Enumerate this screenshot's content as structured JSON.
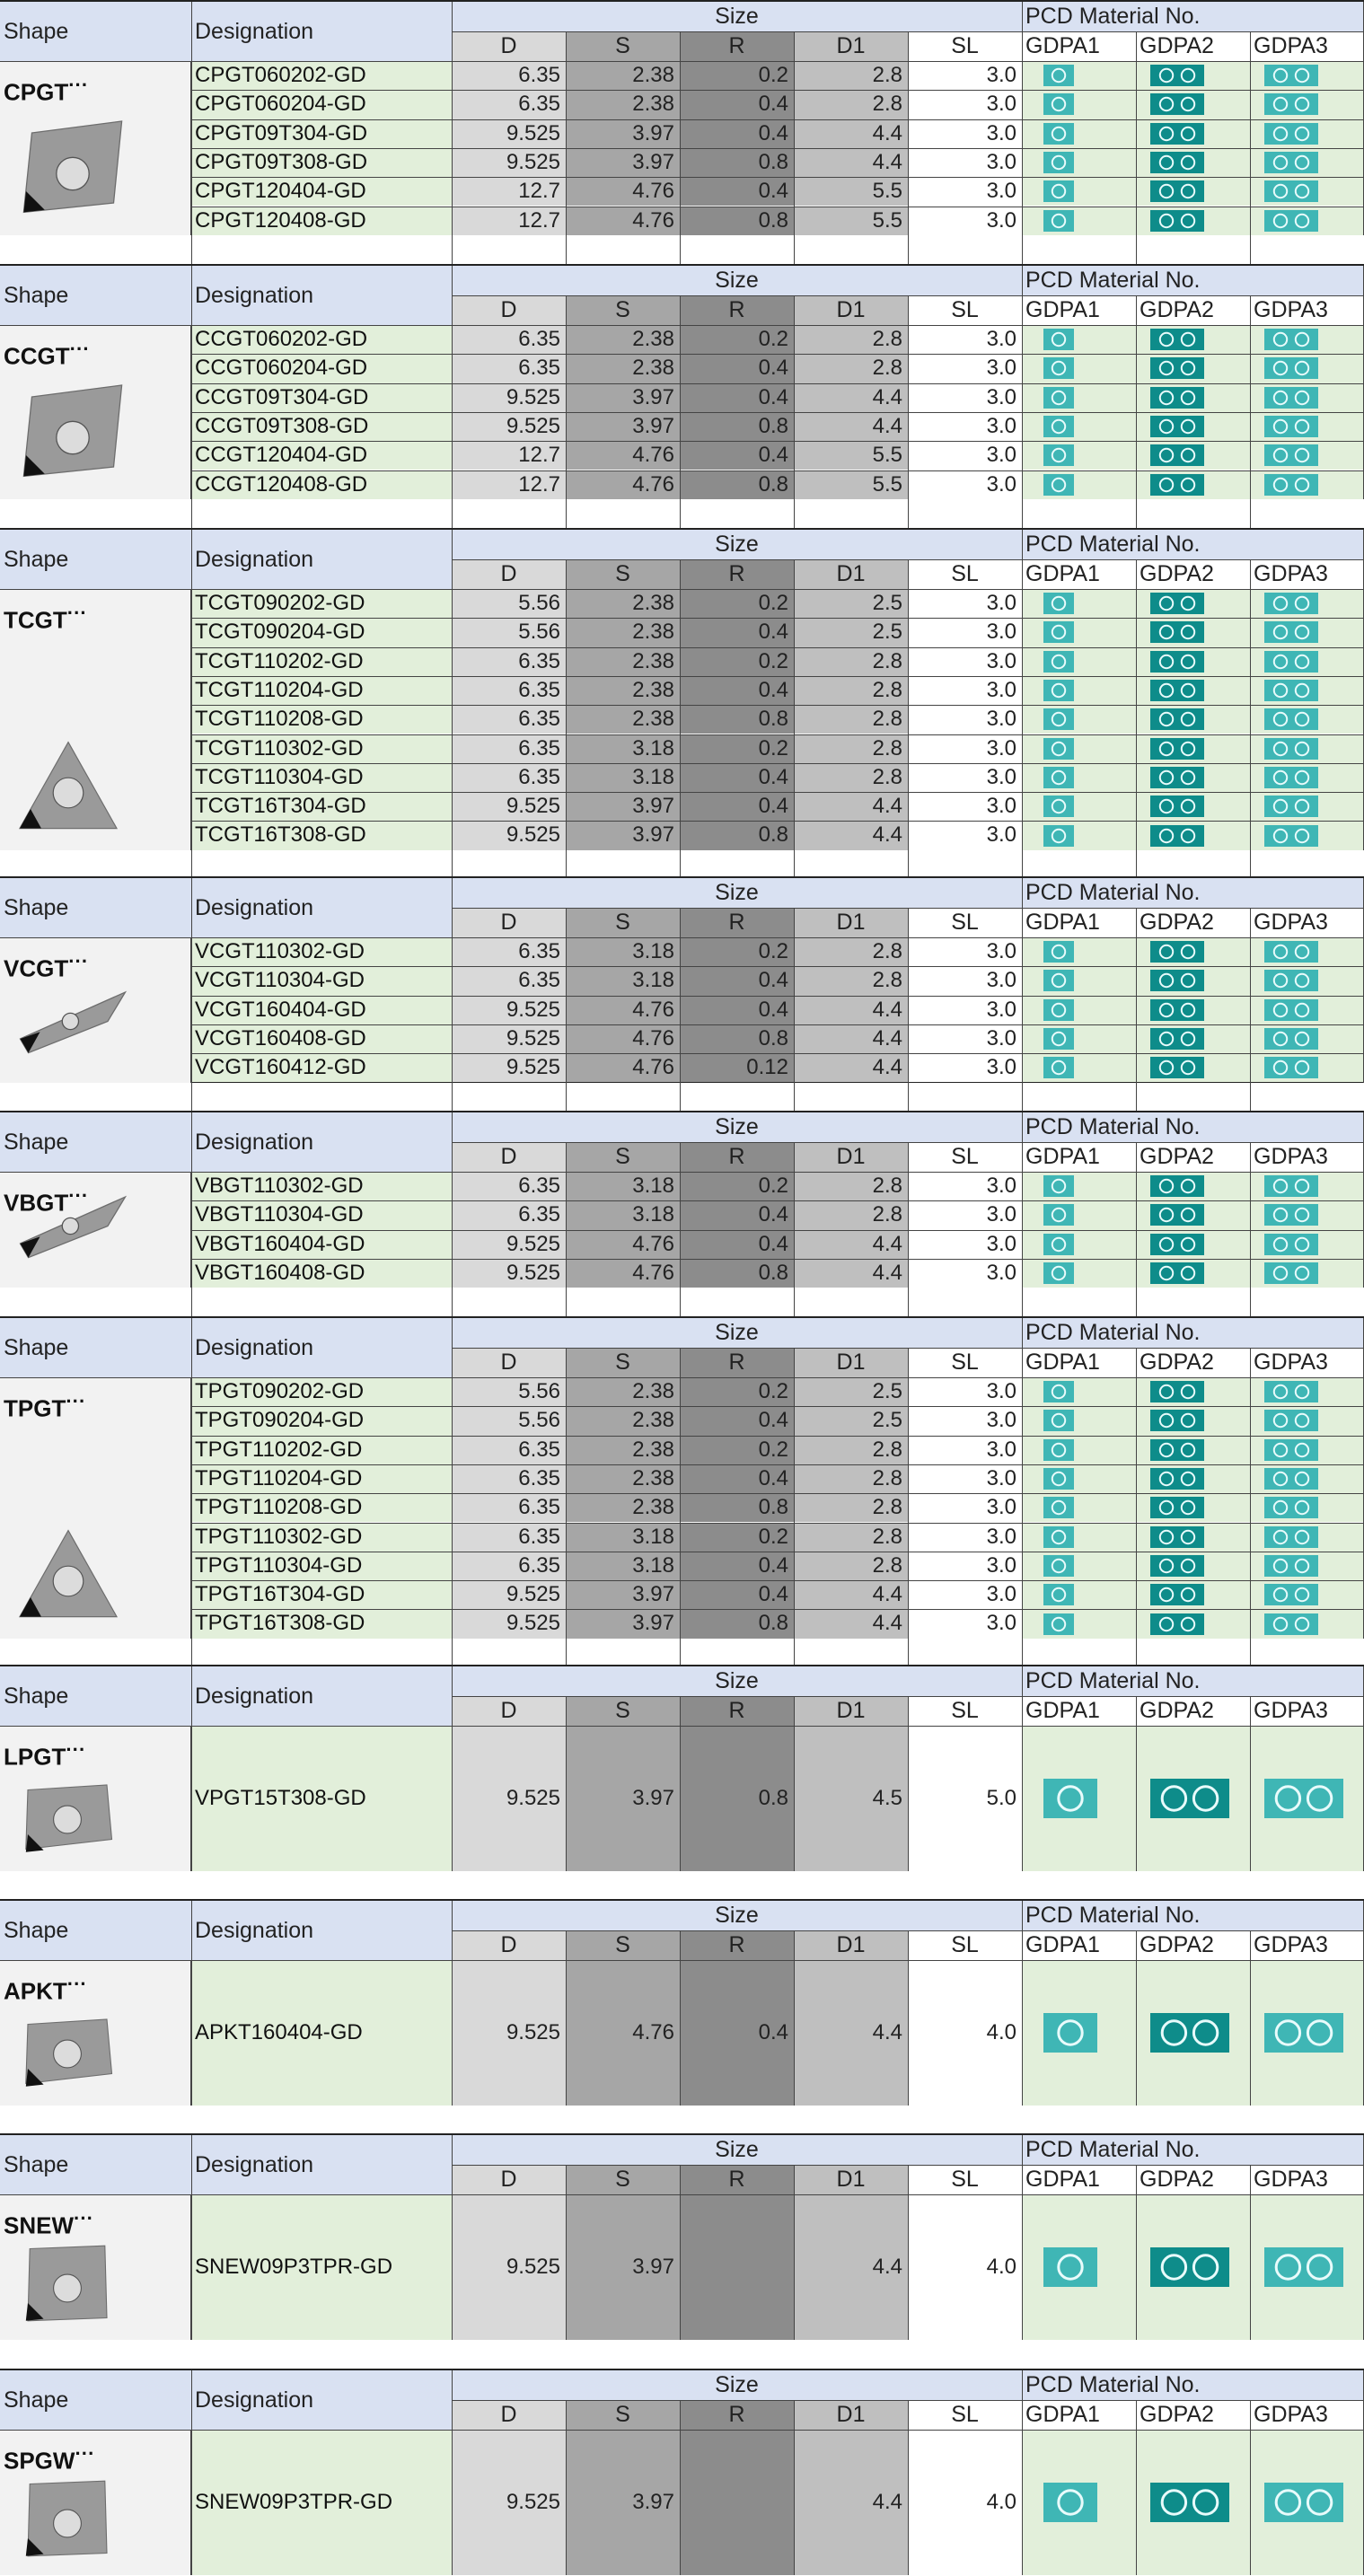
{
  "headers": {
    "shape": "Shape",
    "designation": "Designation",
    "size": "Size",
    "pcd": "PCD Material No.",
    "cols": [
      "D",
      "S",
      "R",
      "D1",
      "SL"
    ],
    "materials": [
      "GDPA1",
      "GDPA2",
      "GDPA3"
    ]
  },
  "colors": {
    "header_blue": "#d9e1f2",
    "row_green": "#e2efda",
    "gray_d": "#d9d9d9",
    "gray_s": "#a6a6a6",
    "gray_r": "#8c8c8c",
    "gray_d1": "#bfbfbf",
    "chip_light": "#3fb6b5",
    "chip_dark": "#0e8c8a"
  },
  "tables": [
    {
      "name": "CPGT",
      "dots": "···",
      "shape_icon": "rhombic-insert-icon",
      "rows": [
        {
          "des": "CPGT060202-GD",
          "D": "6.35",
          "S": "2.38",
          "R": "0.2",
          "D1": "2.8",
          "SL": "3.0"
        },
        {
          "des": "CPGT060204-GD",
          "D": "6.35",
          "S": "2.38",
          "R": "0.4",
          "D1": "2.8",
          "SL": "3.0"
        },
        {
          "des": "CPGT09T304-GD",
          "D": "9.525",
          "S": "3.97",
          "R": "0.4",
          "D1": "4.4",
          "SL": "3.0"
        },
        {
          "des": "CPGT09T308-GD",
          "D": "9.525",
          "S": "3.97",
          "R": "0.8",
          "D1": "4.4",
          "SL": "3.0"
        },
        {
          "des": "CPGT120404-GD",
          "D": "12.7",
          "S": "4.76",
          "R": "0.4",
          "D1": "5.5",
          "SL": "3.0"
        },
        {
          "des": "CPGT120408-GD",
          "D": "12.7",
          "S": "4.76",
          "R": "0.8",
          "D1": "5.5",
          "SL": "3.0"
        }
      ]
    },
    {
      "name": "CCGT",
      "dots": "···",
      "shape_icon": "rhombic-insert-icon",
      "rows": [
        {
          "des": "CCGT060202-GD",
          "D": "6.35",
          "S": "2.38",
          "R": "0.2",
          "D1": "2.8",
          "SL": "3.0"
        },
        {
          "des": "CCGT060204-GD",
          "D": "6.35",
          "S": "2.38",
          "R": "0.4",
          "D1": "2.8",
          "SL": "3.0"
        },
        {
          "des": "CCGT09T304-GD",
          "D": "9.525",
          "S": "3.97",
          "R": "0.4",
          "D1": "4.4",
          "SL": "3.0"
        },
        {
          "des": "CCGT09T308-GD",
          "D": "9.525",
          "S": "3.97",
          "R": "0.8",
          "D1": "4.4",
          "SL": "3.0"
        },
        {
          "des": "CCGT120404-GD",
          "D": "12.7",
          "S": "4.76",
          "R": "0.4",
          "D1": "5.5",
          "SL": "3.0"
        },
        {
          "des": "CCGT120408-GD",
          "D": "12.7",
          "S": "4.76",
          "R": "0.8",
          "D1": "5.5",
          "SL": "3.0"
        }
      ]
    },
    {
      "name": "TCGT",
      "dots": "···",
      "shape_icon": "triangle-insert-icon",
      "rows": [
        {
          "des": "TCGT090202-GD",
          "D": "5.56",
          "S": "2.38",
          "R": "0.2",
          "D1": "2.5",
          "SL": "3.0"
        },
        {
          "des": "TCGT090204-GD",
          "D": "5.56",
          "S": "2.38",
          "R": "0.4",
          "D1": "2.5",
          "SL": "3.0"
        },
        {
          "des": "TCGT110202-GD",
          "D": "6.35",
          "S": "2.38",
          "R": "0.2",
          "D1": "2.8",
          "SL": "3.0"
        },
        {
          "des": "TCGT110204-GD",
          "D": "6.35",
          "S": "2.38",
          "R": "0.4",
          "D1": "2.8",
          "SL": "3.0"
        },
        {
          "des": "TCGT110208-GD",
          "D": "6.35",
          "S": "2.38",
          "R": "0.8",
          "D1": "2.8",
          "SL": "3.0"
        },
        {
          "des": "TCGT110302-GD",
          "D": "6.35",
          "S": "3.18",
          "R": "0.2",
          "D1": "2.8",
          "SL": "3.0"
        },
        {
          "des": "TCGT110304-GD",
          "D": "6.35",
          "S": "3.18",
          "R": "0.4",
          "D1": "2.8",
          "SL": "3.0"
        },
        {
          "des": "TCGT16T304-GD",
          "D": "9.525",
          "S": "3.97",
          "R": "0.4",
          "D1": "4.4",
          "SL": "3.0"
        },
        {
          "des": "TCGT16T308-GD",
          "D": "9.525",
          "S": "3.97",
          "R": "0.8",
          "D1": "4.4",
          "SL": "3.0"
        }
      ]
    },
    {
      "name": "VCGT",
      "dots": "···",
      "shape_icon": "diamond-insert-icon",
      "rows": [
        {
          "des": "VCGT110302-GD",
          "D": "6.35",
          "S": "3.18",
          "R": "0.2",
          "D1": "2.8",
          "SL": "3.0"
        },
        {
          "des": "VCGT110304-GD",
          "D": "6.35",
          "S": "3.18",
          "R": "0.4",
          "D1": "2.8",
          "SL": "3.0"
        },
        {
          "des": "VCGT160404-GD",
          "D": "9.525",
          "S": "4.76",
          "R": "0.4",
          "D1": "4.4",
          "SL": "3.0"
        },
        {
          "des": "VCGT160408-GD",
          "D": "9.525",
          "S": "4.76",
          "R": "0.8",
          "D1": "4.4",
          "SL": "3.0"
        },
        {
          "des": "VCGT160412-GD",
          "D": "9.525",
          "S": "4.76",
          "R": "0.12",
          "D1": "4.4",
          "SL": "3.0"
        }
      ]
    },
    {
      "name": "VBGT",
      "dots": "···",
      "shape_icon": "diamond-insert-icon",
      "rows": [
        {
          "des": "VBGT110302-GD",
          "D": "6.35",
          "S": "3.18",
          "R": "0.2",
          "D1": "2.8",
          "SL": "3.0"
        },
        {
          "des": "VBGT110304-GD",
          "D": "6.35",
          "S": "3.18",
          "R": "0.4",
          "D1": "2.8",
          "SL": "3.0"
        },
        {
          "des": "VBGT160404-GD",
          "D": "9.525",
          "S": "4.76",
          "R": "0.4",
          "D1": "4.4",
          "SL": "3.0"
        },
        {
          "des": "VBGT160408-GD",
          "D": "9.525",
          "S": "4.76",
          "R": "0.8",
          "D1": "4.4",
          "SL": "3.0"
        }
      ]
    },
    {
      "name": "TPGT",
      "dots": "···",
      "shape_icon": "triangle-insert-icon",
      "rows": [
        {
          "des": "TPGT090202-GD",
          "D": "5.56",
          "S": "2.38",
          "R": "0.2",
          "D1": "2.5",
          "SL": "3.0"
        },
        {
          "des": "TPGT090204-GD",
          "D": "5.56",
          "S": "2.38",
          "R": "0.4",
          "D1": "2.5",
          "SL": "3.0"
        },
        {
          "des": "TPGT110202-GD",
          "D": "6.35",
          "S": "2.38",
          "R": "0.2",
          "D1": "2.8",
          "SL": "3.0"
        },
        {
          "des": "TPGT110204-GD",
          "D": "6.35",
          "S": "2.38",
          "R": "0.4",
          "D1": "2.8",
          "SL": "3.0"
        },
        {
          "des": "TPGT110208-GD",
          "D": "6.35",
          "S": "2.38",
          "R": "0.8",
          "D1": "2.8",
          "SL": "3.0"
        },
        {
          "des": "TPGT110302-GD",
          "D": "6.35",
          "S": "3.18",
          "R": "0.2",
          "D1": "2.8",
          "SL": "3.0"
        },
        {
          "des": "TPGT110304-GD",
          "D": "6.35",
          "S": "3.18",
          "R": "0.4",
          "D1": "2.8",
          "SL": "3.0"
        },
        {
          "des": "TPGT16T304-GD",
          "D": "9.525",
          "S": "3.97",
          "R": "0.4",
          "D1": "4.4",
          "SL": "3.0"
        },
        {
          "des": "TPGT16T308-GD",
          "D": "9.525",
          "S": "3.97",
          "R": "0.8",
          "D1": "4.4",
          "SL": "3.0"
        }
      ]
    },
    {
      "name": "LPGT",
      "dots": "···",
      "shape_icon": "rectangular-insert-icon",
      "rows": [
        {
          "des": "VPGT15T308-GD",
          "D": "9.525",
          "S": "3.97",
          "R": "0.8",
          "D1": "4.5",
          "SL": "5.0"
        }
      ]
    },
    {
      "name": "APKT",
      "dots": "···",
      "shape_icon": "rectangular-insert-icon",
      "rows": [
        {
          "des": "APKT160404-GD",
          "D": "9.525",
          "S": "4.76",
          "R": "0.4",
          "D1": "4.4",
          "SL": "4.0"
        }
      ]
    },
    {
      "name": "SNEW",
      "dots": "···",
      "shape_icon": "square-insert-icon",
      "rows": [
        {
          "des": "SNEW09P3TPR-GD",
          "D": "9.525",
          "S": "3.97",
          "R": "",
          "D1": "4.4",
          "SL": "4.0"
        }
      ]
    },
    {
      "name": "SPGW",
      "dots": "···",
      "shape_icon": "square-insert-icon",
      "rows": [
        {
          "des": "SNEW09P3TPR-GD",
          "D": "9.525",
          "S": "3.97",
          "R": "",
          "D1": "4.4",
          "SL": "4.0"
        }
      ]
    }
  ]
}
